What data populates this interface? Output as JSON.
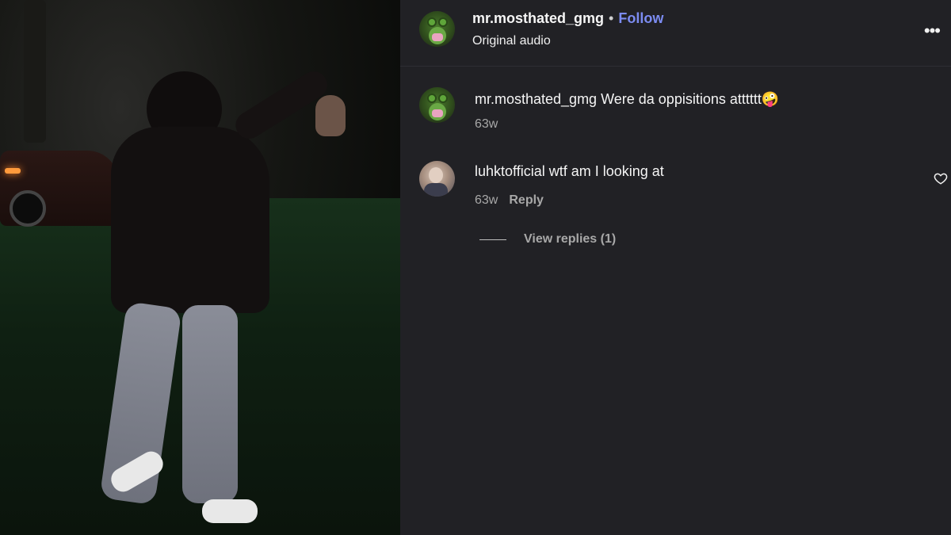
{
  "post": {
    "username": "mr.mosthated_gmg",
    "separator": "•",
    "follow_label": "Follow",
    "audio_label": "Original audio",
    "more_label": "•••"
  },
  "comments": [
    {
      "username": "mr.mosthated_gmg",
      "text": "Were da oppisitions atttttt🤪",
      "age": "63w",
      "avatar": "frog-avatar"
    },
    {
      "username": "luhktofficial",
      "text": "wtf am I looking at",
      "age": "63w",
      "reply_label": "Reply",
      "avatar": "person-avatar",
      "view_replies_label": "View replies (1)"
    }
  ],
  "colors": {
    "follow": "#7c8cf2",
    "panel_bg": "#212125",
    "meta_text": "#a8a8a8"
  }
}
